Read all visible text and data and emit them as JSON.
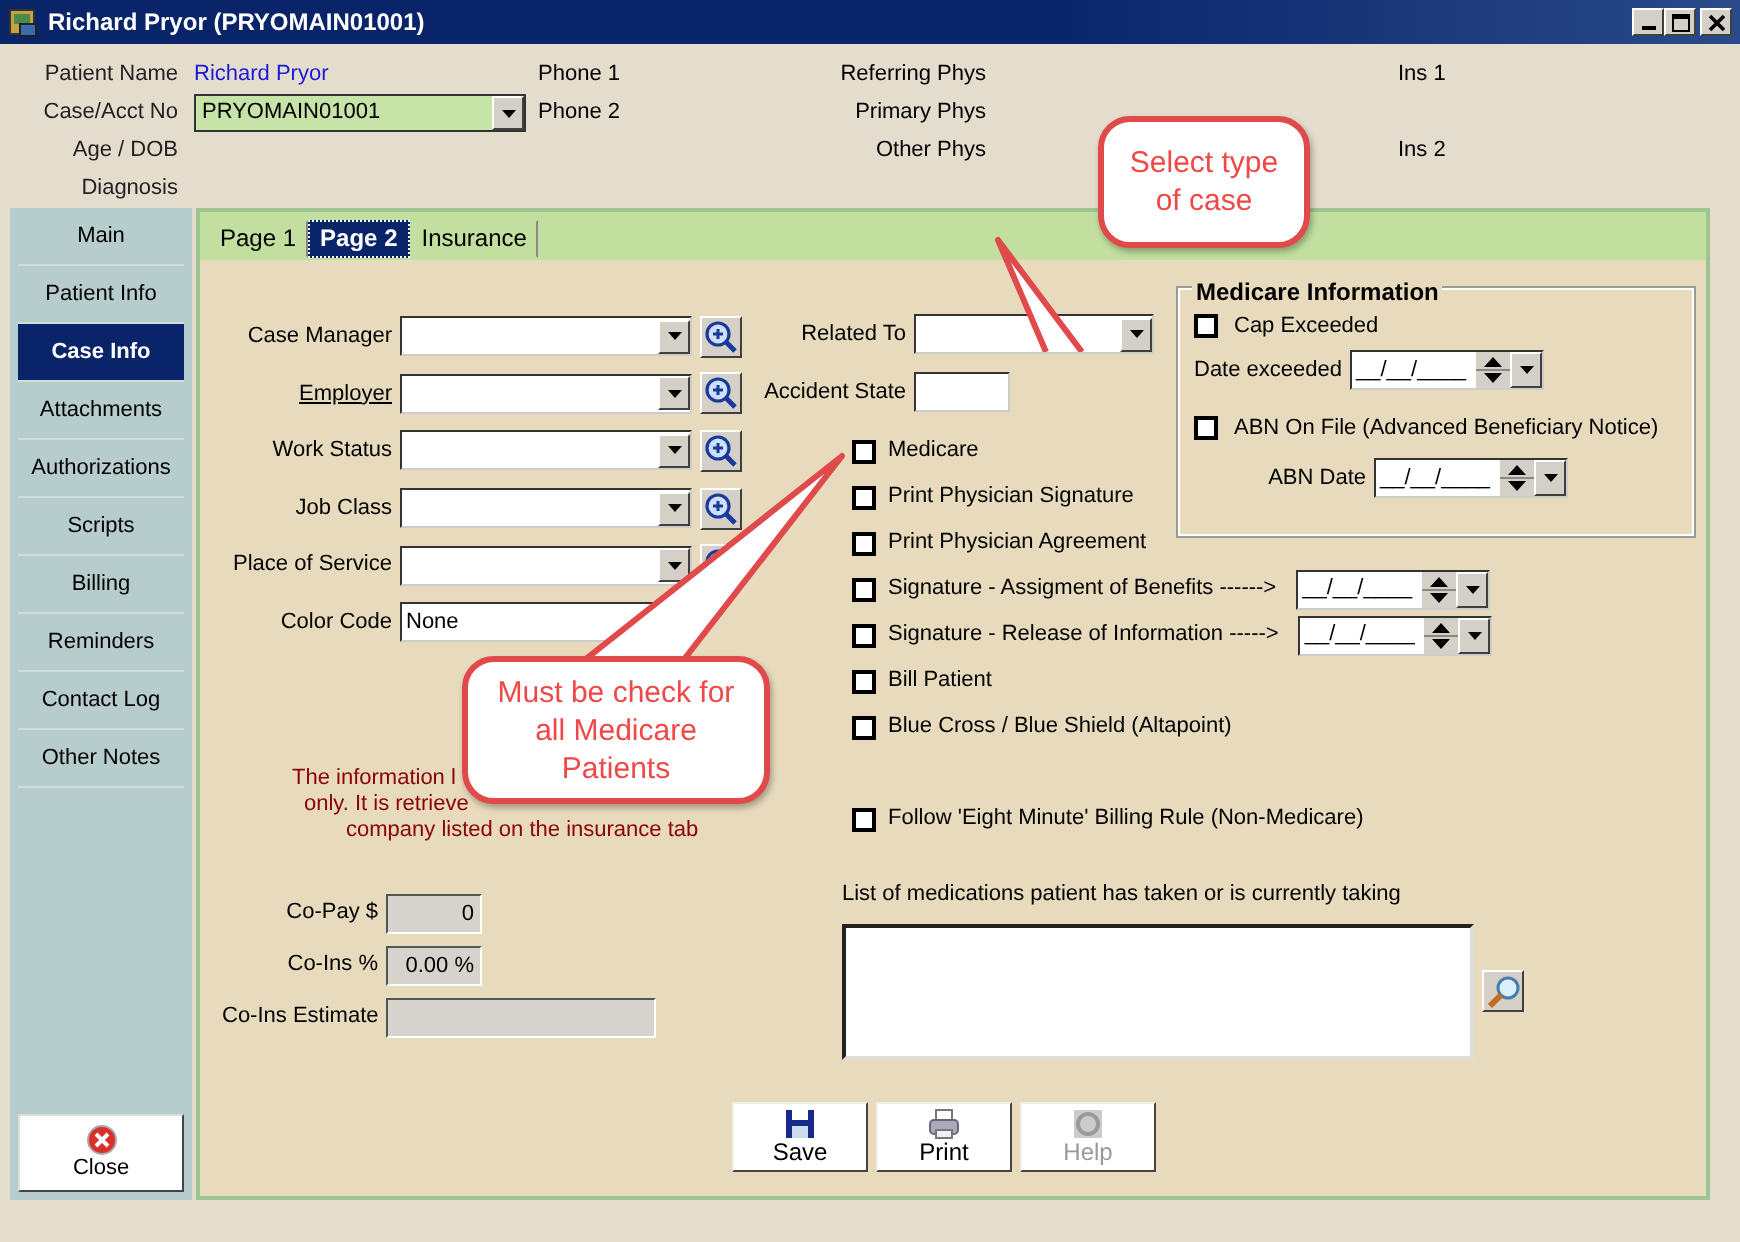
{
  "window": {
    "title": "Richard Pryor (PRYOMAIN01001)"
  },
  "header": {
    "fields": [
      {
        "label": "Patient Name",
        "value": "Richard Pryor",
        "kind": "link"
      },
      {
        "label": "Case/Acct No",
        "value": "PRYOMAIN01001",
        "kind": "combo"
      },
      {
        "label": "Age / DOB",
        "kind": "empty"
      },
      {
        "label": "Diagnosis",
        "kind": "empty"
      }
    ],
    "phones": [
      "Phone 1",
      "Phone 2"
    ],
    "physicians": [
      "Referring Phys",
      "Primary Phys",
      "Other Phys"
    ],
    "insurance": [
      "Ins 1",
      "Ins 2"
    ]
  },
  "sidebar": {
    "items": [
      {
        "label": "Main",
        "selected": false
      },
      {
        "label": "Patient Info",
        "selected": false
      },
      {
        "label": "Case Info",
        "selected": true
      },
      {
        "label": "Attachments",
        "selected": false
      },
      {
        "label": "Authorizations",
        "selected": false
      },
      {
        "label": "Scripts",
        "selected": false
      },
      {
        "label": "Billing",
        "selected": false
      },
      {
        "label": "Reminders",
        "selected": false
      },
      {
        "label": "Contact Log",
        "selected": false
      },
      {
        "label": "Other Notes",
        "selected": false
      }
    ],
    "close_button": "Close"
  },
  "tabs": [
    {
      "label": "Page 1",
      "selected": false
    },
    {
      "label": "Page 2",
      "selected": true
    },
    {
      "label": "Insurance",
      "selected": false
    }
  ],
  "case_fields": [
    {
      "label": "Case Manager",
      "kind": "combo"
    },
    {
      "label": "Employer",
      "kind": "link-combo"
    },
    {
      "label": "Work Status",
      "kind": "combo"
    },
    {
      "label": "Job Class",
      "kind": "combo"
    },
    {
      "label": "Place of Service",
      "kind": "combo"
    },
    {
      "label": "Color Code",
      "kind": "text",
      "value": "None"
    }
  ],
  "info_text": [
    "The information l",
    "only. It is retrieve",
    "company listed on the insurance tab"
  ],
  "amounts": [
    {
      "label": "Co-Pay $",
      "value": "0",
      "kind": "short"
    },
    {
      "label": "Co-Ins %",
      "value": "0.00 %",
      "kind": "short"
    },
    {
      "label": "Co-Ins Estimate",
      "kind": "long"
    }
  ],
  "related_to": {
    "label": "Related To"
  },
  "accident_state": {
    "label": "Accident State"
  },
  "checkboxes": [
    {
      "label": "Medicare",
      "checked": false,
      "kind": "plain"
    },
    {
      "label": "Print Physician Signature",
      "checked": false,
      "kind": "plain"
    },
    {
      "label": "Print Physician Agreement",
      "checked": false,
      "kind": "plain"
    },
    {
      "label": "Signature - Assigment of Benefits ------>",
      "checked": false,
      "kind": "date",
      "value": "__/__/____"
    },
    {
      "label": "Signature - Release of Information ----->",
      "checked": false,
      "kind": "date",
      "value": "__/__/____"
    },
    {
      "label": "Bill Patient",
      "checked": false,
      "kind": "plain"
    },
    {
      "label": "Blue Cross / Blue Shield (Altapoint)",
      "checked": false,
      "kind": "plain"
    },
    {
      "label": "Follow 'Eight Minute' Billing Rule (Non-Medicare)",
      "checked": false,
      "kind": "spaced"
    }
  ],
  "medicare_info": {
    "title": "Medicare Information",
    "cap_exceeded": {
      "label": "Cap Exceeded",
      "checked": false
    },
    "date_exceeded": {
      "label": "Date exceeded",
      "value": "__/__/____"
    },
    "abn_on_file": {
      "label": "ABN On File (Advanced Beneficiary Notice)",
      "checked": false
    },
    "abn_date": {
      "label": "ABN Date",
      "value": "__/__/____"
    }
  },
  "medications": {
    "label": "List of medications patient has taken or is currently taking"
  },
  "buttons": [
    {
      "label": "Save",
      "kind": "save",
      "disabled": false
    },
    {
      "label": "Print",
      "kind": "print",
      "disabled": false
    },
    {
      "label": "Help",
      "kind": "help",
      "disabled": true
    }
  ],
  "callouts": [
    {
      "text": "Select type of case",
      "kind": "case-type"
    },
    {
      "text": "Must be check for all Medicare Patients",
      "kind": "medicare"
    }
  ]
}
